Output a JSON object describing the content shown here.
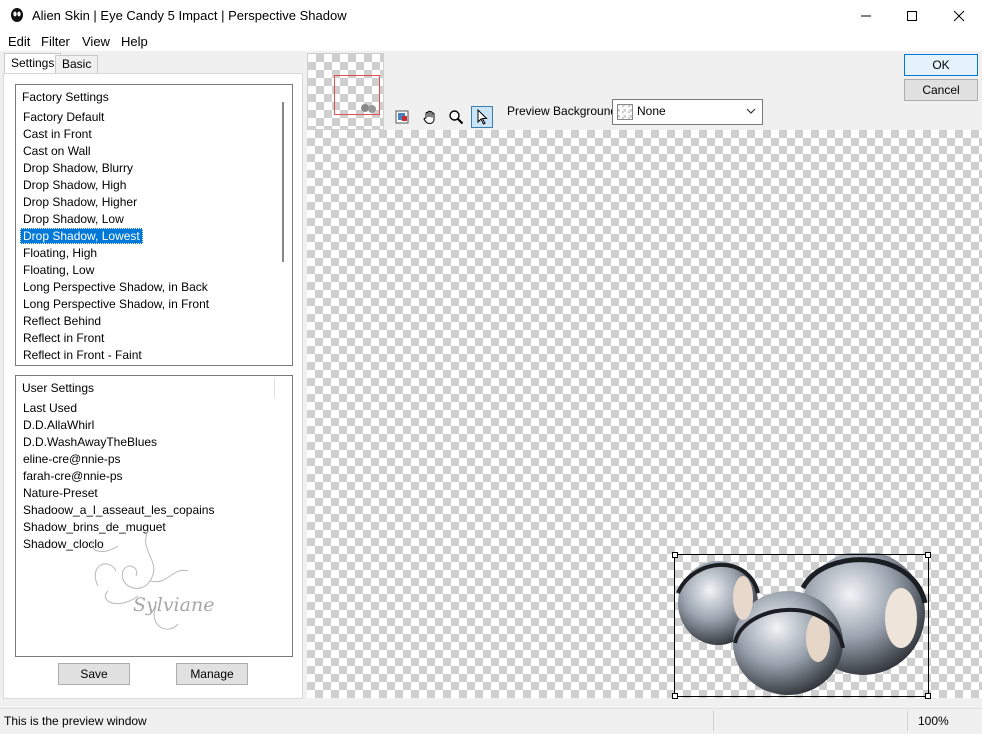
{
  "window": {
    "title": "Alien Skin | Eye Candy 5 Impact | Perspective Shadow"
  },
  "menu": [
    "Edit",
    "Filter",
    "View",
    "Help"
  ],
  "tabs": {
    "settings": "Settings",
    "basic": "Basic"
  },
  "factory": {
    "header": "Factory Settings",
    "items": [
      "Factory Default",
      "Cast in Front",
      "Cast on Wall",
      "Drop Shadow, Blurry",
      "Drop Shadow, High",
      "Drop Shadow, Higher",
      "Drop Shadow, Low",
      "Drop Shadow, Lowest",
      "Floating, High",
      "Floating, Low",
      "Long Perspective Shadow, in Back",
      "Long Perspective Shadow, in Front",
      "Reflect Behind",
      "Reflect in Front",
      "Reflect in Front - Faint"
    ],
    "selected": "Drop Shadow, Lowest"
  },
  "user": {
    "header": "User Settings",
    "items": [
      "Last Used",
      "D.D.AllaWhirl",
      "D.D.WashAwayTheBlues",
      "eline-cre@nnie-ps",
      "farah-cre@nnie-ps",
      "Nature-Preset",
      "Shadoow_a_l_asseaut_les_copains",
      "Shadow_brins_de_muguet",
      "Shadow_cloclo"
    ],
    "watermark": "Sylviane"
  },
  "buttons": {
    "save": "Save",
    "manage": "Manage",
    "ok": "OK",
    "cancel": "Cancel"
  },
  "preview": {
    "bg_label": "Preview Background:",
    "bg_value": "None"
  },
  "status": {
    "text": "This is the preview window",
    "zoom": "100%"
  },
  "colors": {
    "selection": "#0078d7",
    "nav_rect": "#e05050"
  },
  "icons": [
    "app-icon",
    "minimize-icon",
    "maximize-icon",
    "close-icon",
    "navigator-tool-icon",
    "hand-tool-icon",
    "zoom-tool-icon",
    "select-tool-icon",
    "chevron-down-icon"
  ]
}
